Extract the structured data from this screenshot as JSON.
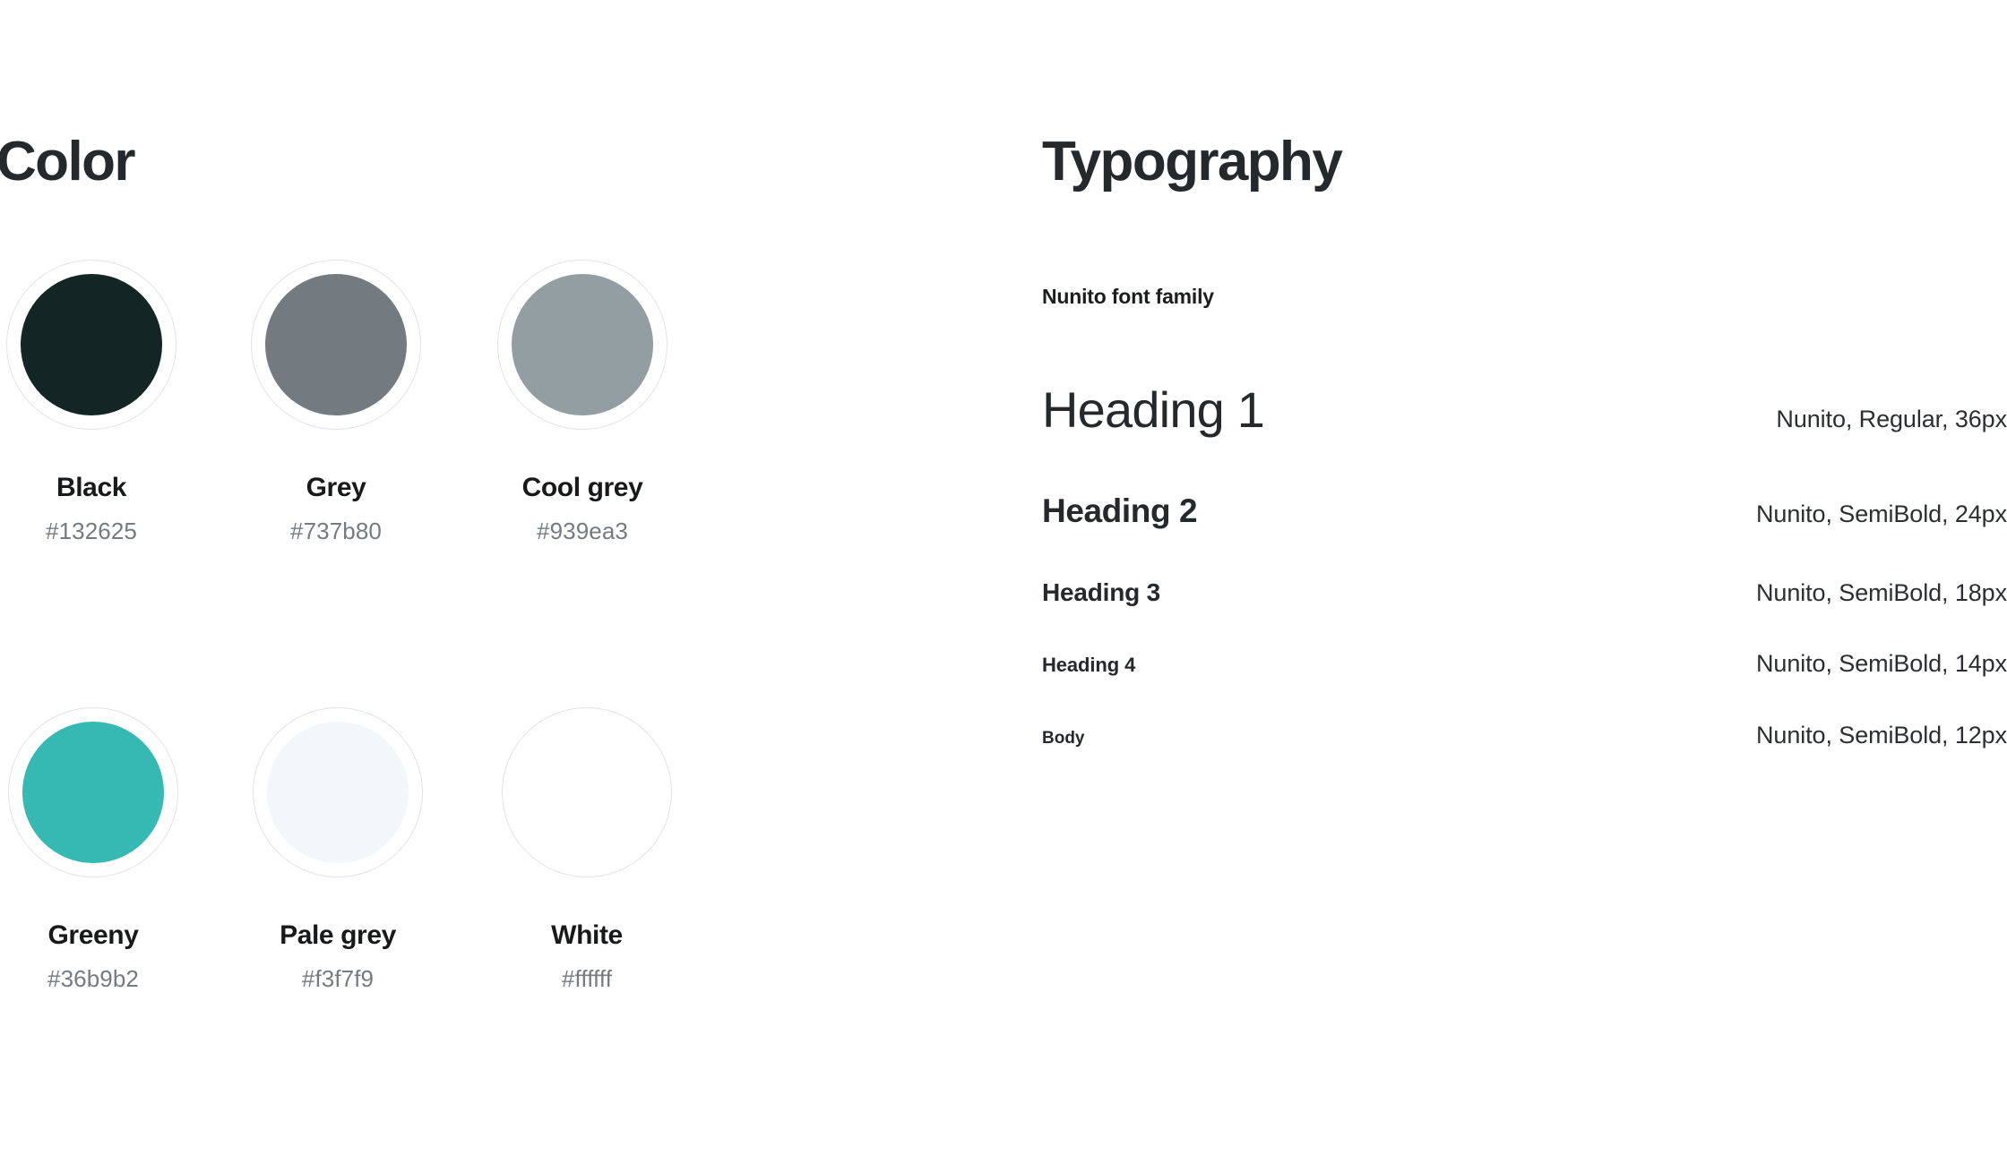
{
  "color": {
    "title": "Color",
    "ring_border_color": "#dfe4e9",
    "name_text_color": "#18191a",
    "hex_text_color": "#757b80",
    "swatches": [
      {
        "name": "Black",
        "hex": "#132625"
      },
      {
        "name": "Grey",
        "hex": "#737b80"
      },
      {
        "name": "Cool grey",
        "hex": "#939ea3"
      },
      {
        "name": "Greeny",
        "hex": "#36b9b2"
      },
      {
        "name": "Pale grey",
        "hex": "#f3f7f9"
      },
      {
        "name": "White",
        "hex": "#ffffff"
      }
    ]
  },
  "typography": {
    "title": "Typography",
    "font_family_label": "Nunito font family",
    "rows": [
      {
        "sample": "Heading 1",
        "spec": "Nunito, Regular, 36px"
      },
      {
        "sample": "Heading 2",
        "spec": "Nunito, SemiBold, 24px"
      },
      {
        "sample": "Heading 3",
        "spec": "Nunito, SemiBold, 18px"
      },
      {
        "sample": "Heading 4",
        "spec": "Nunito, SemiBold, 14px"
      },
      {
        "sample": "Body",
        "spec": "Nunito, SemiBold, 12px"
      }
    ]
  }
}
